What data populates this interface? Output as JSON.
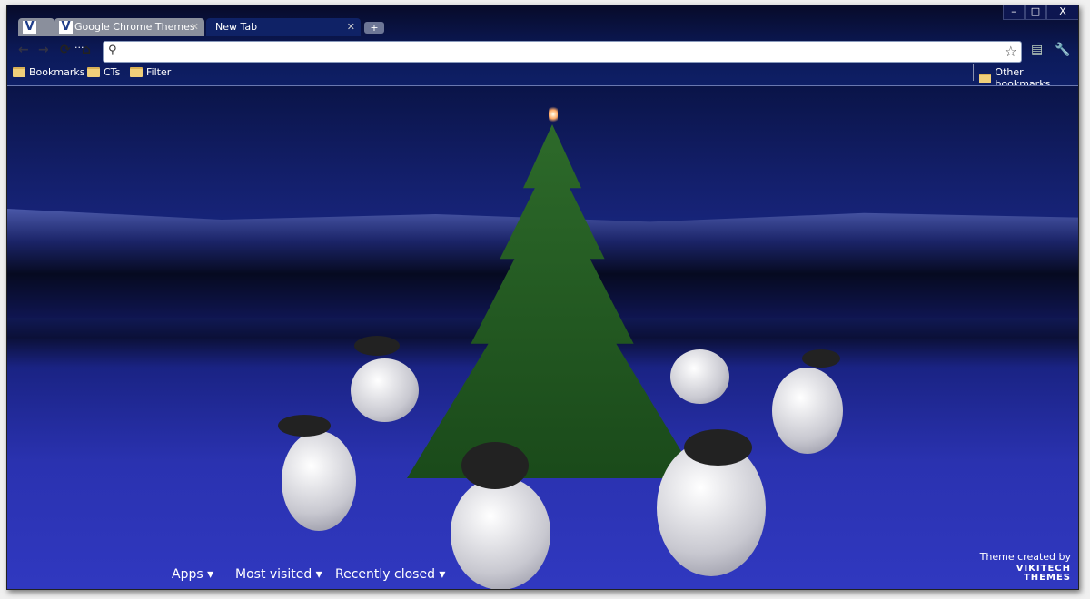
{
  "tabs": [
    {
      "title": "",
      "icon": "vikitech-favicon"
    },
    {
      "title": "Google Chrome Themes ...",
      "icon": "vikitech-favicon"
    },
    {
      "title": "New Tab",
      "active": true
    }
  ],
  "window_controls": {
    "minimize": "–",
    "maximize": "□",
    "close": "X"
  },
  "omnibox": {
    "value": "",
    "placeholder": ""
  },
  "bookmarks": [
    "Bookmarks",
    "CTs",
    "Filter"
  ],
  "other_bookmarks": "Other bookmarks",
  "ntp": {
    "apps": "Apps ▾",
    "most_visited": "Most visited ▾",
    "recently_closed": "Recently closed ▾"
  },
  "credit": {
    "text": "Theme created by",
    "logo_line1": "VIKITECH",
    "logo_line2": "THEMES"
  },
  "colors": {
    "frame": "#0e1f66",
    "accent_snow": "#2a32b0"
  }
}
